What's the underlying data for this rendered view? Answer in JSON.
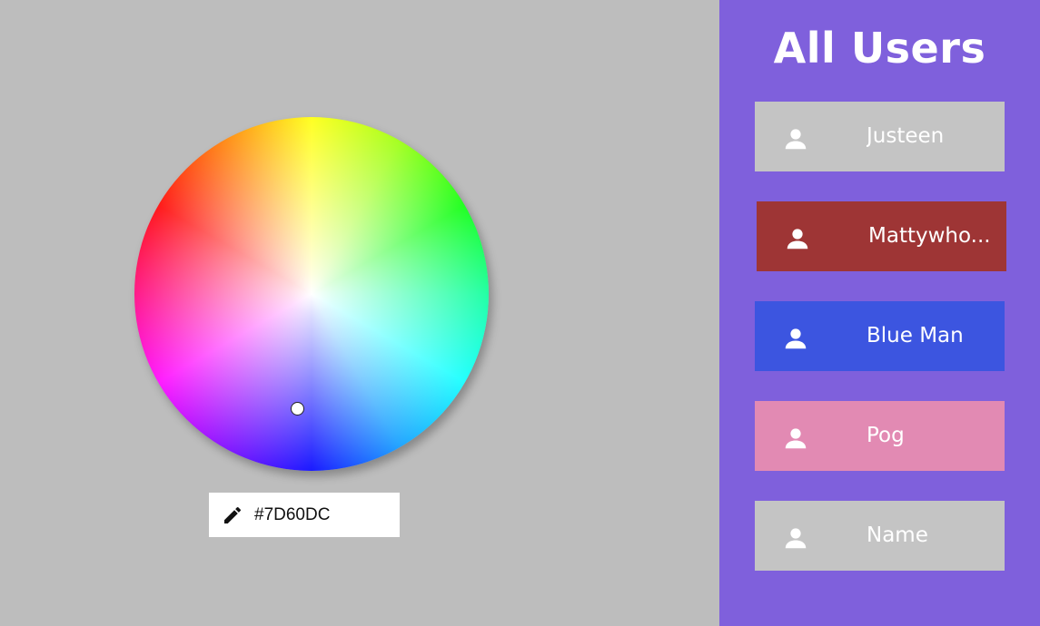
{
  "color_picker": {
    "hex_value": "#7D60DC",
    "selected_color": "#7D60DC"
  },
  "sidebar": {
    "title": "All Users",
    "background": "#7F60DC",
    "users": [
      {
        "name": "Justeen",
        "color": "#C4C4C4"
      },
      {
        "name": "Mattywho...",
        "color": "#9E3535"
      },
      {
        "name": "Blue Man",
        "color": "#3C55E0"
      },
      {
        "name": "Pog",
        "color": "#E28AB3"
      },
      {
        "name": "Name",
        "color": "#C4C4C4"
      }
    ]
  },
  "icons": {
    "edit": "pencil-icon",
    "user": "person-icon"
  }
}
